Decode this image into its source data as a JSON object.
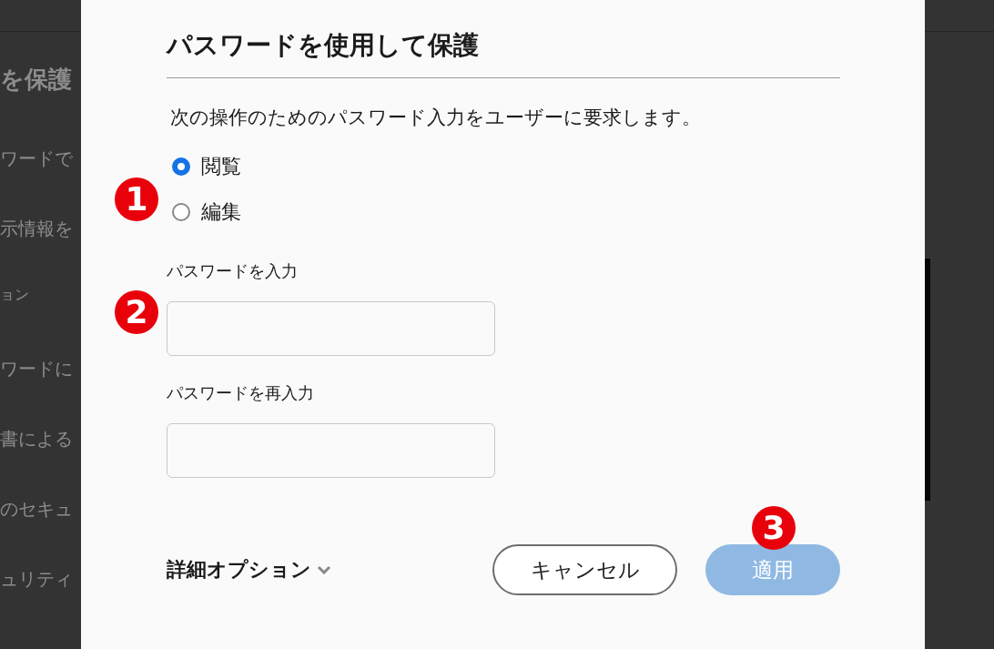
{
  "background_panel": {
    "heading": "を保護",
    "items": [
      {
        "kind": "item",
        "text": "ワードで"
      },
      {
        "kind": "item",
        "text": "示情報を"
      },
      {
        "kind": "section",
        "text": "ョン"
      },
      {
        "kind": "item",
        "text": "ワードに"
      },
      {
        "kind": "item",
        "text": "書による"
      },
      {
        "kind": "item",
        "text": "のセキュ"
      },
      {
        "kind": "item",
        "text": "ュリティ"
      }
    ]
  },
  "dialog": {
    "title": "パスワードを使用して保護",
    "description": "次の操作のためのパスワード入力をユーザーに要求します。",
    "options": [
      {
        "label": "閲覧",
        "selected": true
      },
      {
        "label": "編集",
        "selected": false
      }
    ],
    "fields": [
      {
        "label": "パスワードを入力"
      },
      {
        "label": "パスワードを再入力"
      }
    ],
    "more_options": "詳細オプション",
    "buttons": [
      {
        "kind": "secondary",
        "label": "キャンセル"
      },
      {
        "kind": "primary",
        "label": "適用",
        "disabled": true
      }
    ]
  },
  "callouts": [
    "1",
    "2",
    "3"
  ]
}
